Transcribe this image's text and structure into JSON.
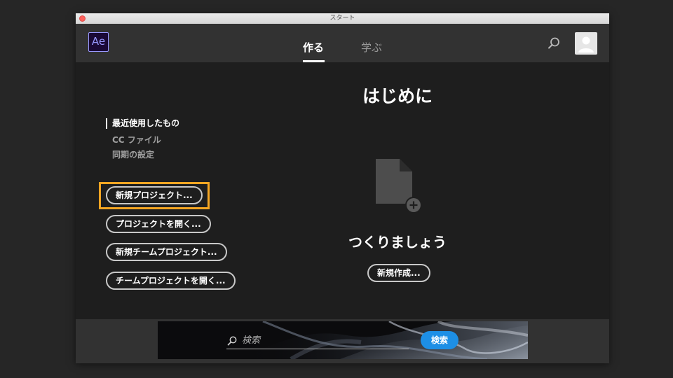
{
  "window": {
    "title": "スタート"
  },
  "header": {
    "app_logo_text": "Ae",
    "tabs": [
      {
        "label": "作る",
        "active": true
      },
      {
        "label": "学ぶ",
        "active": false
      }
    ],
    "icons": {
      "search": "search-icon",
      "avatar": "avatar-icon"
    }
  },
  "sidebar": {
    "nav": [
      {
        "label": "最近使用したもの",
        "active": true
      },
      {
        "label": "CC ファイル",
        "active": false
      },
      {
        "label": "同期の設定",
        "active": false
      }
    ],
    "buttons": [
      {
        "label": "新規プロジェクト..."
      },
      {
        "label": "プロジェクトを開く..."
      },
      {
        "label": "新規チームプロジェクト..."
      },
      {
        "label": "チームプロジェクトを開く..."
      }
    ]
  },
  "main": {
    "title": "はじめに",
    "empty_state_text": "つくりましょう",
    "create_button_label": "新規作成..."
  },
  "footer": {
    "search_placeholder": "検索",
    "search_button_label": "検索"
  },
  "colors": {
    "accent_blue": "#1d8fe6",
    "highlight_orange": "#f5a623",
    "ae_logo_purple": "#9999ff",
    "ae_logo_bg": "#1a0936"
  }
}
